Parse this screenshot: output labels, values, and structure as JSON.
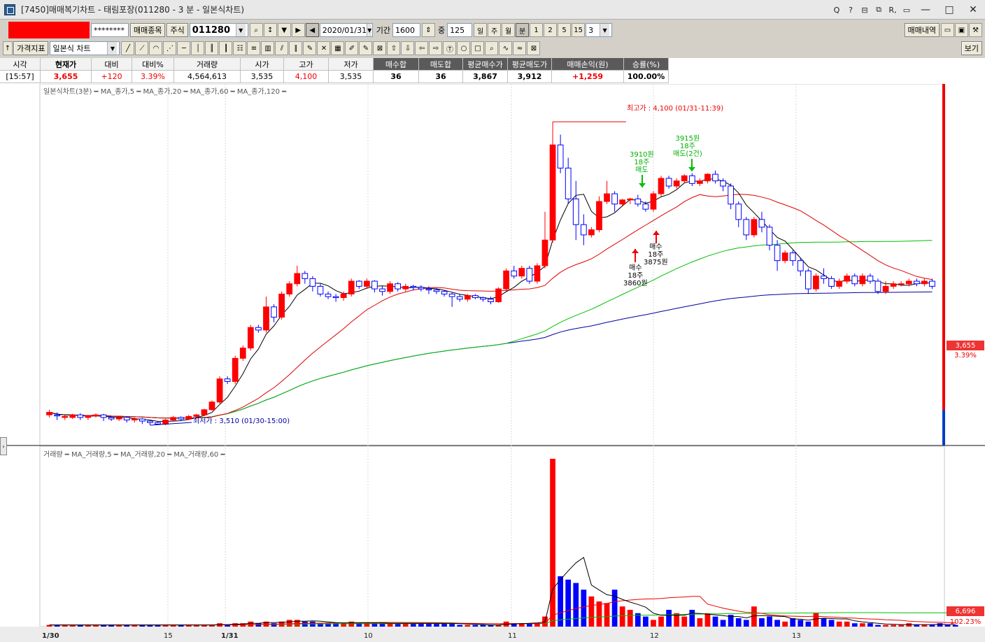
{
  "window": {
    "title": "[7450]매매복기차트 - 태림포장(011280 - 3 분 - 일본식차트)",
    "controls": [
      "Q",
      "?",
      "⊟",
      "⧉",
      "R,",
      "▭",
      "—",
      "□",
      "✕"
    ]
  },
  "toolbar1": {
    "password_mask": "********",
    "trade_item_button": "매매종목",
    "market_label": "주식",
    "code_value": "011280",
    "date_value": "2020/01/31",
    "period_label": "기간",
    "period_value": "1600",
    "count_label": "중",
    "count_value": "125",
    "period_buttons": [
      "일",
      "주",
      "월",
      "분"
    ],
    "minute_buttons": [
      "1",
      "2",
      "5",
      "15"
    ],
    "minute_select": "3",
    "history_button": "매매내역"
  },
  "toolbar2": {
    "indicator_button": "가격지표",
    "chart_type_value": "일본식 차트",
    "view_button": "보기"
  },
  "quote": {
    "headers": [
      "시각",
      "현재가",
      "대비",
      "대비%",
      "거래량",
      "시가",
      "고가",
      "저가",
      "매수합",
      "매도합",
      "평균매수가",
      "평균매도가",
      "매매손익(원)",
      "승률(%)"
    ],
    "values": [
      "[15:57]",
      "3,655",
      "+120",
      "3.39%",
      "4,564,613",
      "3,535",
      "4,100",
      "3,535",
      "36",
      "36",
      "3,867",
      "3,912",
      "+1,259",
      "100.00%"
    ]
  },
  "price_panel": {
    "legend": "일본식차트(3분) ━ MA_종가,5 ━ MA_종가,20 ━ MA_종가,60 ━ MA_종가,120 ━",
    "high_note": "최고가 : 4,100 (01/31-11:39)",
    "low_note": "최저가 : 3,510 (01/30-15:00)",
    "current_price": "3,655",
    "change_pct": "3.39%",
    "buy1": [
      "매수",
      "18주",
      "3860원"
    ],
    "buy2": [
      "매수",
      "18주",
      "3875원"
    ],
    "sell1": [
      "3910원",
      "18주",
      "매도"
    ],
    "sell2": [
      "3915원",
      "18주",
      "매도(2건)"
    ]
  },
  "volume_panel": {
    "legend": "거래량 ━ MA_거래량,5 ━ MA_거래량,20 ━ MA_거래량,60 ━",
    "last_volume": "6,696",
    "volume_pct": "102.23%"
  },
  "x_ticks": [
    "1/30",
    "15",
    "1/31",
    "10",
    "11",
    "12",
    "13"
  ],
  "chart_data": {
    "type": "candlestick",
    "title": "",
    "y_range": [
      3480,
      4160
    ],
    "ma_colors": {
      "ma5": "#000000",
      "ma20": "#e00000",
      "ma60": "#00c000",
      "ma120": "#0000a0"
    },
    "up_color": "#ff0000",
    "down_color": "#0000ff",
    "candles": [
      [
        3530,
        3535,
        3525,
        3540
      ],
      [
        3530,
        3528,
        3520,
        3535
      ],
      [
        3525,
        3527,
        3520,
        3530
      ],
      [
        3525,
        3530,
        3522,
        3532
      ],
      [
        3530,
        3525,
        3520,
        3533
      ],
      [
        3525,
        3528,
        3520,
        3530
      ],
      [
        3528,
        3530,
        3525,
        3533
      ],
      [
        3530,
        3525,
        3518,
        3532
      ],
      [
        3525,
        3522,
        3518,
        3528
      ],
      [
        3522,
        3525,
        3518,
        3528
      ],
      [
        3525,
        3520,
        3515,
        3527
      ],
      [
        3520,
        3522,
        3515,
        3525
      ],
      [
        3522,
        3518,
        3512,
        3524
      ],
      [
        3518,
        3515,
        3510,
        3520
      ],
      [
        3515,
        3512,
        3510,
        3518
      ],
      [
        3512,
        3520,
        3510,
        3522
      ],
      [
        3520,
        3525,
        3518,
        3528
      ],
      [
        3525,
        3522,
        3518,
        3527
      ],
      [
        3522,
        3527,
        3520,
        3530
      ],
      [
        3527,
        3530,
        3525,
        3532
      ],
      [
        3530,
        3540,
        3528,
        3542
      ],
      [
        3540,
        3555,
        3538,
        3558
      ],
      [
        3555,
        3600,
        3552,
        3605
      ],
      [
        3600,
        3595,
        3590,
        3605
      ],
      [
        3595,
        3640,
        3590,
        3645
      ],
      [
        3640,
        3660,
        3635,
        3665
      ],
      [
        3660,
        3700,
        3655,
        3705
      ],
      [
        3700,
        3695,
        3690,
        3705
      ],
      [
        3695,
        3740,
        3690,
        3760
      ],
      [
        3740,
        3720,
        3710,
        3745
      ],
      [
        3720,
        3765,
        3715,
        3770
      ],
      [
        3765,
        3785,
        3760,
        3790
      ],
      [
        3785,
        3805,
        3780,
        3820
      ],
      [
        3805,
        3795,
        3785,
        3810
      ],
      [
        3795,
        3780,
        3770,
        3800
      ],
      [
        3780,
        3765,
        3760,
        3785
      ],
      [
        3765,
        3760,
        3755,
        3770
      ],
      [
        3760,
        3758,
        3750,
        3765
      ],
      [
        3758,
        3765,
        3752,
        3770
      ],
      [
        3765,
        3790,
        3760,
        3795
      ],
      [
        3790,
        3780,
        3775,
        3792
      ],
      [
        3780,
        3790,
        3775,
        3795
      ],
      [
        3790,
        3775,
        3768,
        3792
      ],
      [
        3775,
        3770,
        3762,
        3780
      ],
      [
        3770,
        3785,
        3765,
        3790
      ],
      [
        3785,
        3775,
        3770,
        3788
      ],
      [
        3775,
        3780,
        3770,
        3785
      ],
      [
        3780,
        3778,
        3772,
        3783
      ],
      [
        3778,
        3775,
        3770,
        3782
      ],
      [
        3775,
        3773,
        3765,
        3780
      ],
      [
        3773,
        3770,
        3765,
        3776
      ],
      [
        3770,
        3765,
        3760,
        3773
      ],
      [
        3765,
        3760,
        3740,
        3768
      ],
      [
        3760,
        3755,
        3750,
        3765
      ],
      [
        3755,
        3762,
        3750,
        3765
      ],
      [
        3762,
        3758,
        3755,
        3765
      ],
      [
        3758,
        3755,
        3750,
        3760
      ],
      [
        3755,
        3750,
        3745,
        3760
      ],
      [
        3750,
        3775,
        3748,
        3778
      ],
      [
        3775,
        3810,
        3770,
        3815
      ],
      [
        3810,
        3800,
        3795,
        3820
      ],
      [
        3800,
        3815,
        3795,
        3820
      ],
      [
        3815,
        3790,
        3785,
        3820
      ],
      [
        3790,
        3820,
        3785,
        3825
      ],
      [
        3820,
        3870,
        3815,
        3925
      ],
      [
        3870,
        4055,
        3865,
        4100
      ],
      [
        4055,
        4010,
        4000,
        4075
      ],
      [
        4010,
        3950,
        3940,
        4030
      ],
      [
        3950,
        3900,
        3870,
        3985
      ],
      [
        3900,
        3880,
        3860,
        3920
      ],
      [
        3880,
        3890,
        3875,
        3895
      ],
      [
        3890,
        3945,
        3885,
        3955
      ],
      [
        3945,
        3960,
        3940,
        3985
      ],
      [
        3960,
        3940,
        3925,
        3965
      ],
      [
        3940,
        3948,
        3935,
        3950
      ],
      [
        3948,
        3950,
        3940,
        3952
      ],
      [
        3950,
        3940,
        3935,
        3958
      ],
      [
        3940,
        3930,
        3925,
        3945
      ],
      [
        3930,
        3960,
        3925,
        3965
      ],
      [
        3960,
        3990,
        3955,
        3995
      ],
      [
        3990,
        3975,
        3970,
        3995
      ],
      [
        3975,
        3985,
        3970,
        3990
      ],
      [
        3985,
        3995,
        3980,
        3998
      ],
      [
        3995,
        3980,
        3975,
        4000
      ],
      [
        3980,
        3985,
        3975,
        3990
      ],
      [
        3985,
        3998,
        3980,
        4000
      ],
      [
        3998,
        3985,
        3980,
        4005
      ],
      [
        3985,
        3975,
        3965,
        3990
      ],
      [
        3975,
        3940,
        3930,
        3980
      ],
      [
        3940,
        3910,
        3895,
        3945
      ],
      [
        3910,
        3880,
        3870,
        3915
      ],
      [
        3880,
        3910,
        3875,
        3915
      ],
      [
        3910,
        3895,
        3885,
        3925
      ],
      [
        3895,
        3860,
        3850,
        3900
      ],
      [
        3860,
        3830,
        3810,
        3870
      ],
      [
        3830,
        3845,
        3825,
        3850
      ],
      [
        3845,
        3830,
        3820,
        3850
      ],
      [
        3830,
        3810,
        3800,
        3835
      ],
      [
        3810,
        3775,
        3765,
        3815
      ],
      [
        3775,
        3800,
        3770,
        3805
      ],
      [
        3800,
        3795,
        3785,
        3815
      ],
      [
        3795,
        3780,
        3775,
        3800
      ],
      [
        3780,
        3790,
        3775,
        3795
      ],
      [
        3790,
        3800,
        3785,
        3805
      ],
      [
        3800,
        3785,
        3780,
        3805
      ],
      [
        3785,
        3800,
        3780,
        3805
      ],
      [
        3800,
        3790,
        3785,
        3805
      ],
      [
        3790,
        3770,
        3765,
        3795
      ],
      [
        3770,
        3780,
        3765,
        3790
      ],
      [
        3780,
        3785,
        3775,
        3790
      ],
      [
        3785,
        3785,
        3780,
        3790
      ],
      [
        3785,
        3790,
        3780,
        3795
      ],
      [
        3790,
        3785,
        3780,
        3795
      ],
      [
        3785,
        3790,
        3780,
        3795
      ],
      [
        3790,
        3780,
        3775,
        3795
      ]
    ],
    "volume_scale_max": 100,
    "volumes": [
      1,
      1,
      1,
      1,
      1,
      1,
      1,
      1,
      1,
      1,
      1,
      1,
      1,
      1,
      1,
      1,
      1,
      1,
      1,
      1,
      1,
      1,
      2,
      1,
      2,
      2,
      3,
      2,
      3,
      2,
      3,
      4,
      4,
      3,
      3,
      2,
      2,
      2,
      2,
      3,
      2,
      2,
      2,
      2,
      2,
      2,
      2,
      2,
      2,
      2,
      2,
      2,
      2,
      1,
      1,
      1,
      1,
      1,
      1,
      3,
      2,
      2,
      2,
      2,
      6,
      100,
      30,
      28,
      26,
      22,
      18,
      15,
      14,
      22,
      12,
      10,
      8,
      6,
      4,
      6,
      10,
      8,
      6,
      10,
      5,
      8,
      6,
      4,
      7,
      5,
      4,
      12,
      5,
      6,
      4,
      3,
      5,
      4,
      3,
      8,
      5,
      4,
      3,
      3,
      2,
      2,
      2,
      1,
      1,
      1,
      1,
      2,
      1,
      1,
      1,
      2,
      1,
      1
    ]
  }
}
